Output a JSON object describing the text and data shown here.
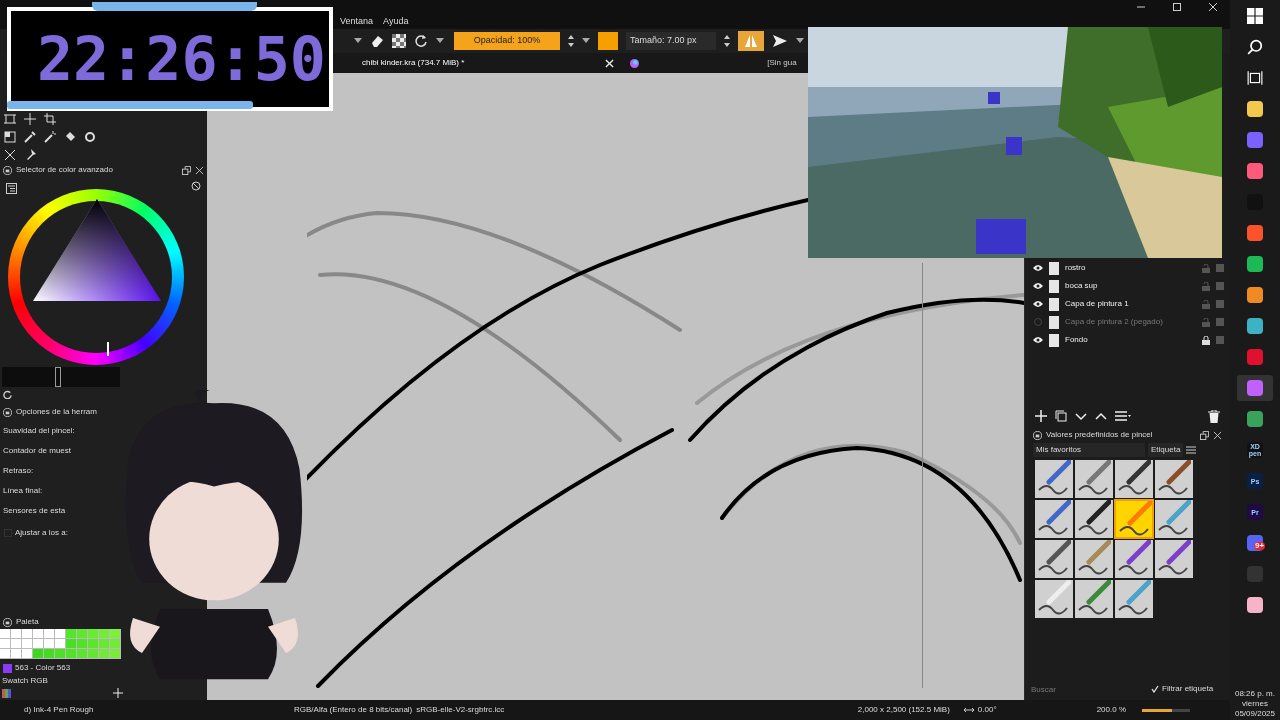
{
  "menu": [
    {
      "label": "Ventana"
    },
    {
      "label": "Ayuda"
    }
  ],
  "clock": {
    "time": "22:26:50"
  },
  "toolbar": {
    "opacity": "Opacidad: 100%",
    "opacity_slider": {
      "level": 1
    },
    "size": "Tamaño: 7.00 px",
    "mirror_on": true
  },
  "tabs": [
    {
      "title": "chibi kinder.kra (734.7 MiB) *",
      "selected": true
    },
    {
      "title": "[Sin gua",
      "selected": false
    }
  ],
  "color_selector": {
    "title": "Selector de color avanzado",
    "slider": {
      "level": 0.47
    }
  },
  "tool_options": {
    "title": "Opciones de la herram",
    "fields": [
      "Suavidad del pincel:",
      "Contador de muest",
      "Retraso:",
      "Línea final:",
      "Sensores de esta"
    ],
    "checkbox": {
      "label": "Ajustar a los a:",
      "checked": false
    }
  },
  "palette": {
    "title": "Paleta",
    "rows": [
      [
        {
          "color": "#ffffff"
        },
        {
          "color": "#ffffff"
        },
        {
          "color": "#ffffff"
        },
        {
          "color": "#ffffff"
        },
        {
          "color": "#ffffff"
        },
        {
          "color": "#ffffff"
        },
        {
          "color": "#55e52a"
        },
        {
          "color": "#5fe82e"
        },
        {
          "color": "#69ea33"
        },
        {
          "color": "#74ec37"
        },
        {
          "color": "#7fee3c"
        }
      ],
      [
        {
          "color": "#ffffff"
        },
        {
          "color": "#ffffff"
        },
        {
          "color": "#ffffff"
        },
        {
          "color": "#ffffff"
        },
        {
          "color": "#ffffff"
        },
        {
          "color": "#ffffff"
        },
        {
          "color": "#48e024"
        },
        {
          "color": "#52e328"
        },
        {
          "color": "#5ce52d"
        },
        {
          "color": "#67e832"
        },
        {
          "color": "#72ea36"
        }
      ],
      [
        {
          "color": "#ffffff"
        },
        {
          "color": "#ffffff"
        },
        {
          "color": "#ffffff"
        },
        {
          "color": "#3dd91f"
        },
        {
          "color": "#44dc22"
        },
        {
          "color": "#4cdf26"
        },
        {
          "color": "#54e12a"
        },
        {
          "color": "#5de42e"
        },
        {
          "color": "#66e632"
        },
        {
          "color": "#70e937"
        },
        {
          "color": "#7aeb3b"
        }
      ]
    ],
    "current": {
      "label": "563 - Color 563",
      "color": "#8a3cf5"
    },
    "swatch_set": "Swatch RGB"
  },
  "layers": [
    {
      "name": "rostro",
      "visible": true,
      "locked": false
    },
    {
      "name": "boca sup",
      "visible": true,
      "locked": false
    },
    {
      "name": "Capa de pintura 1",
      "visible": true,
      "locked": false
    },
    {
      "name": "Capa de pintura 2 (pegado)",
      "visible": false,
      "locked": false
    },
    {
      "name": "Fondo",
      "visible": true,
      "locked": true
    }
  ],
  "brush_presets": {
    "title": "Valores predefinidos de pincel",
    "tag": "Mis favoritos",
    "tag_button": "Etiqueta",
    "presets": [
      {
        "selected": false
      },
      {
        "selected": false
      },
      {
        "selected": false
      },
      {
        "selected": false
      },
      {
        "selected": false
      },
      {
        "selected": false
      },
      {
        "selected": true
      },
      {
        "selected": false
      },
      {
        "selected": false
      },
      {
        "selected": false
      },
      {
        "selected": false
      },
      {
        "selected": false
      },
      {
        "selected": false
      },
      {
        "selected": false
      },
      {
        "selected": false
      }
    ],
    "search_placeholder": "Buscar",
    "filter": {
      "label": "Filtrar etiqueta",
      "checked": true
    }
  },
  "status_bar": {
    "brush": "d) Ink-4 Pen Rough",
    "color_space": "RGB/Alfa (Entero de 8 bits/canal)",
    "profile": "sRGB-elle-V2-srgbtrc.icc",
    "dimensions": "2,000 x 2,500 (152.5 MiB)",
    "rotation": "0.00°",
    "zoom": "200.0 %",
    "zoom_slider": {
      "level": 0.62
    }
  },
  "taskbar": {
    "apps": [
      {
        "kind": "start",
        "selected": false
      },
      {
        "kind": "search",
        "selected": false
      },
      {
        "kind": "taskview",
        "selected": false
      },
      {
        "kind": "app",
        "color": "#f2c94c",
        "selected": false
      },
      {
        "kind": "app",
        "color": "#7b61ff",
        "selected": false
      },
      {
        "kind": "app",
        "color": "#ff5a79",
        "selected": false
      },
      {
        "kind": "app",
        "color": "#111111",
        "selected": false
      },
      {
        "kind": "app",
        "color": "#fb542b",
        "selected": false
      },
      {
        "kind": "app",
        "color": "#1db954",
        "selected": false
      },
      {
        "kind": "app",
        "color": "#f08a24",
        "selected": false
      },
      {
        "kind": "app",
        "color": "#3bb3c3",
        "selected": false
      },
      {
        "kind": "app",
        "color": "#e0102f",
        "selected": false
      },
      {
        "kind": "app",
        "color": "#c060ff",
        "selected": true
      },
      {
        "kind": "app",
        "color": "#3aa35b",
        "selected": false
      },
      {
        "kind": "app",
        "color": "#111111",
        "label": "XD pen",
        "selected": false
      },
      {
        "kind": "app",
        "color": "#0a1f44",
        "label": "Ps",
        "selected": false
      },
      {
        "kind": "app",
        "color": "#1f0a44",
        "label": "Pr",
        "selected": false
      },
      {
        "kind": "app",
        "color": "#5865f2",
        "badge": "9+",
        "selected": false
      },
      {
        "kind": "app",
        "color": "#333333",
        "selected": false
      },
      {
        "kind": "app",
        "color": "#f7b3c8",
        "selected": false
      }
    ],
    "time": "08:26 p. m.",
    "day": "viernes",
    "date": "05/09/2025"
  }
}
